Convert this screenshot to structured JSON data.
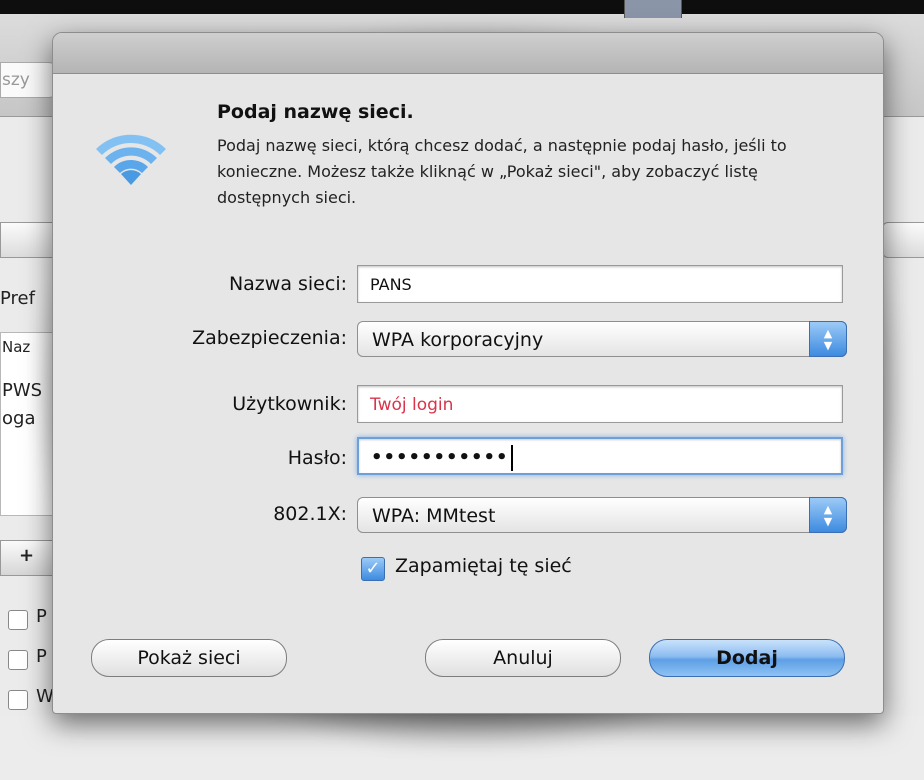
{
  "background": {
    "search_partial": "szy",
    "prefs_partial": "Pref",
    "column_partial": "Naz",
    "row1_partial": "PWS",
    "row2_partial": "oga",
    "plus_label": "+",
    "check1_partial": "P",
    "check2_partial": "P",
    "check3_partial": "W"
  },
  "dialog": {
    "title": "Podaj nazwę sieci.",
    "description": "Podaj nazwę sieci, którą chcesz dodać, a następnie podaj hasło, jeśli to konieczne. Możesz także kliknąć w „Pokaż sieci\", aby zobaczyć listę dostępnych sieci.",
    "fields": {
      "network_name": {
        "label": "Nazwa sieci:",
        "value": "PANS"
      },
      "security": {
        "label": "Zabezpieczenia:",
        "value": "WPA korporacyjny"
      },
      "user": {
        "label": "Użytkownik:",
        "value": "Twój  login",
        "value_color": "#d9344a"
      },
      "password": {
        "label": "Hasło:",
        "value": "•••••••••••"
      },
      "eap": {
        "label": "802.1X:",
        "value": "WPA: MMtest"
      }
    },
    "remember_label": "Zapamiętaj tę sieć",
    "buttons": {
      "show_networks": "Pokaż sieci",
      "cancel": "Anuluj",
      "add": "Dodaj"
    },
    "icons": {
      "wifi": "wifi-icon",
      "popup_arrows": "up-down-arrows-icon",
      "check": "checkmark-icon"
    },
    "accent_color": "#3d8be0"
  }
}
